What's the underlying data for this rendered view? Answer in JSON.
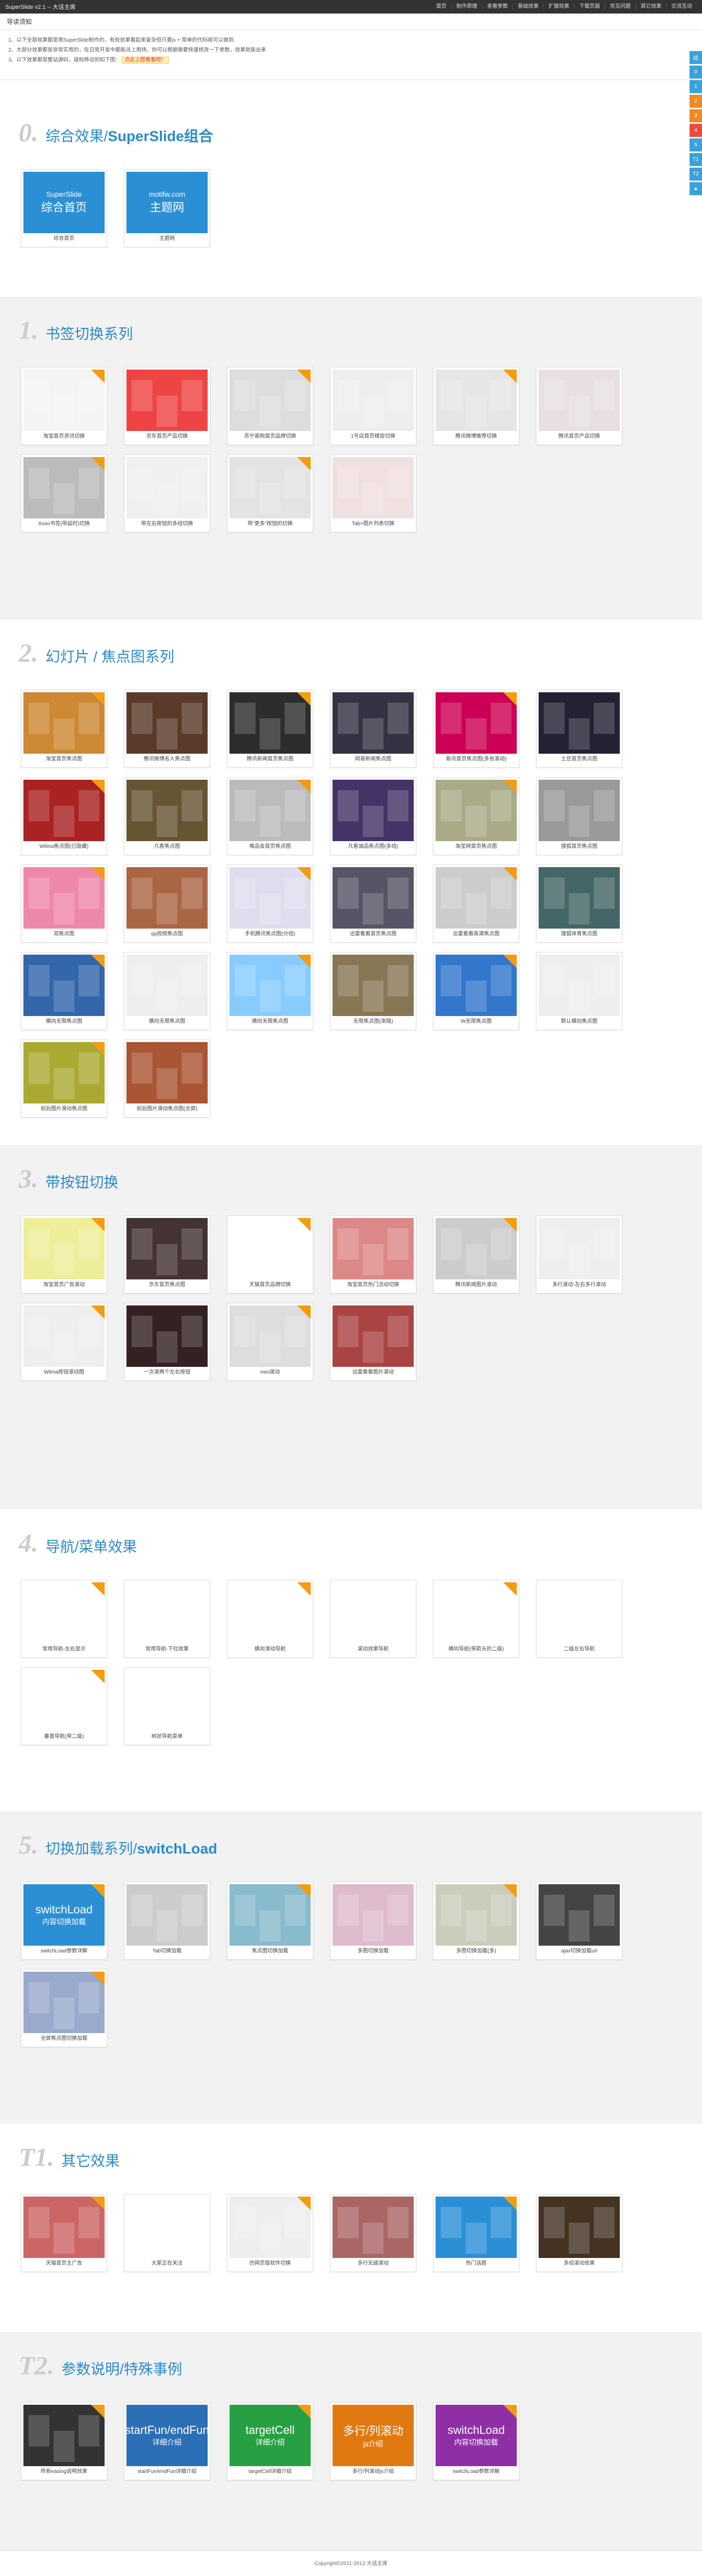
{
  "topbar": {
    "brand": "SuperSlide v2.1 -- 大话主席",
    "nav": [
      "首页",
      "制作原理",
      "查看参数",
      "基础效果",
      "扩展效果",
      "下载页面",
      "常见问题",
      "其它效果",
      "交流互动"
    ]
  },
  "guide": "导读须知",
  "notes": {
    "n1": "1、以下全部效果都是用SuperSlide制作的，有些效果看起来复杂但只要js + 简单的代码就可以做到",
    "n2": "2、大部分效果都是非常实用的，在日常开发中都能派上用场，你可以根据需要快速修改一下参数，效果就能出来",
    "n3": "3、以下效果都是整站源码，鼠标移动到如下图：",
    "n3_hl": "点此上图看看吧！"
  },
  "side_tabs": [
    {
      "label": "综",
      "color": "#3ba1da"
    },
    {
      "label": "0",
      "color": "#3ba1da"
    },
    {
      "label": "1",
      "color": "#3ba1da"
    },
    {
      "label": "2",
      "color": "#f08a24"
    },
    {
      "label": "3",
      "color": "#f08a24"
    },
    {
      "label": "4",
      "color": "#e84c3d"
    },
    {
      "label": "5",
      "color": "#3ba1da"
    },
    {
      "label": "T1",
      "color": "#3ba1da"
    },
    {
      "label": "T2",
      "color": "#3ba1da"
    },
    {
      "label": "▲",
      "color": "#3ba1da"
    }
  ],
  "sections": [
    {
      "num": "0.",
      "title": "综合效果/",
      "title_b": "SuperSlide组合",
      "cards": [
        {
          "caption": "综合首页",
          "thumb_main": "综合首页",
          "thumb_sub": "SuperSlide",
          "bg": "#2b8fd6"
        },
        {
          "caption": "主题网",
          "thumb_main": "主题网",
          "thumb_sub": "motifw.com",
          "bg": "#2b8fd6"
        }
      ]
    },
    {
      "num": "1.",
      "title": "书签切换系列",
      "title_b": "",
      "cards": [
        {
          "caption": "淘宝首页资讯切换",
          "bg": "#f4f4f4"
        },
        {
          "caption": "京东首页产品切换",
          "bg": "#e44"
        },
        {
          "caption": "苏宁易购首页品牌切换",
          "bg": "#ddd"
        },
        {
          "caption": "1号店首页楼层切换",
          "bg": "#eee"
        },
        {
          "caption": "腾讯微博推荐切换",
          "bg": "#e6e6e6"
        },
        {
          "caption": "腾讯首页产品切换",
          "bg": "#e8e0e0"
        },
        {
          "caption": "Xoxo书签(带延时)切换",
          "bg": "#bbb"
        },
        {
          "caption": "带左右按钮的多组切换",
          "bg": "#f0f0f0"
        },
        {
          "caption": "带\"更多\"按钮的切换",
          "bg": "#e3e3e3"
        },
        {
          "caption": "Tab+图片列表切换",
          "bg": "#f1e0e0"
        }
      ]
    },
    {
      "num": "2.",
      "title": "幻灯片 / 焦点图系列",
      "title_b": "",
      "cards": [
        {
          "caption": "淘宝首页焦点图",
          "bg": "#c83"
        },
        {
          "caption": "腾讯微博名人焦点图",
          "bg": "#5a3a2a"
        },
        {
          "caption": "腾讯新闻首页焦点图",
          "bg": "#2d2d2d"
        },
        {
          "caption": "网易新闻焦点图",
          "bg": "#334"
        },
        {
          "caption": "易讯首页焦点图(多张滚动)",
          "bg": "#c05"
        },
        {
          "caption": "土豆首页焦点图",
          "bg": "#223"
        },
        {
          "caption": "Wilma焦点图(已隐藏)",
          "bg": "#a22"
        },
        {
          "caption": "凡客焦点图",
          "bg": "#653"
        },
        {
          "caption": "唯品会首页焦点图",
          "bg": "#bbb"
        },
        {
          "caption": "凡客诚品焦点图(多组)",
          "bg": "#436"
        },
        {
          "caption": "淘宝网首页焦点图",
          "bg": "#aa8"
        },
        {
          "caption": "搜狐首页焦点图",
          "bg": "#999"
        },
        {
          "caption": "双焦点图",
          "bg": "#e8a"
        },
        {
          "caption": "qq视频焦点图",
          "bg": "#a64"
        },
        {
          "caption": "手机腾讯焦点图(分组)",
          "bg": "#dde"
        },
        {
          "caption": "迅雷看看首页焦点图",
          "bg": "#556"
        },
        {
          "caption": "迅雷看看高清焦点图",
          "bg": "#ccc"
        },
        {
          "caption": "搜狐体育焦点图",
          "bg": "#466"
        },
        {
          "caption": "横向无限焦点图",
          "bg": "#36a"
        },
        {
          "caption": "横向无限焦点图",
          "bg": "#eee"
        },
        {
          "caption": "横向无限焦点图",
          "bg": "#8cf"
        },
        {
          "caption": "无限焦点图(渐隐)",
          "bg": "#875"
        },
        {
          "caption": "W无限焦点图",
          "bg": "#37c"
        },
        {
          "caption": "默认横向焦点图",
          "bg": "#eee"
        },
        {
          "caption": "前后图片滑动焦点图",
          "bg": "#aa3"
        },
        {
          "caption": "前后图片滑动焦点图(全屏)",
          "bg": "#a53"
        }
      ]
    },
    {
      "num": "3.",
      "title": "带按钮切换",
      "title_b": "",
      "cards": [
        {
          "caption": "淘宝首页广告滚动",
          "bg": "#ee9"
        },
        {
          "caption": "京东首页焦点图",
          "bg": "#433"
        },
        {
          "caption": "天猫首页品牌切换",
          "bg": "#fff"
        },
        {
          "caption": "淘宝首页热门活动切换",
          "bg": "#d88"
        },
        {
          "caption": "腾讯新闻图片滚动",
          "bg": "#ccc"
        },
        {
          "caption": "多行滚动-左右多行滚动",
          "bg": "#eee"
        },
        {
          "caption": "Wilma按钮滚动图",
          "bg": "#eee"
        },
        {
          "caption": "一次滚两个左右按钮",
          "bg": "#322"
        },
        {
          "caption": "mini滚动",
          "bg": "#ddd"
        },
        {
          "caption": "迅雷看看图片滚动",
          "bg": "#a44"
        }
      ]
    },
    {
      "num": "4.",
      "title": "导航/菜单效果",
      "title_b": "",
      "cards": [
        {
          "caption": "常用导航-左右显示",
          "bg": "#fff"
        },
        {
          "caption": "常用导航-下拉效果",
          "bg": "#fff"
        },
        {
          "caption": "横向滑动导航",
          "bg": "#fff"
        },
        {
          "caption": "滚动效果导航",
          "bg": "#fff"
        },
        {
          "caption": "横向导航(带箭头的二级)",
          "bg": "#fff"
        },
        {
          "caption": "二级左右导航",
          "bg": "#fff"
        },
        {
          "caption": "垂直导航(带二级)",
          "bg": "#fff"
        },
        {
          "caption": "树状导航菜单",
          "bg": "#fff"
        }
      ]
    },
    {
      "num": "5.",
      "title": "切换加载系列/",
      "title_b": "switchLoad",
      "cards": [
        {
          "caption": "switchLoad参数详解",
          "thumb_main": "switchLoad",
          "thumb_sub": "内容切换加载",
          "bg": "#2b8fd6"
        },
        {
          "caption": "Tab切换加载",
          "bg": "#ccc"
        },
        {
          "caption": "焦点图切换加载",
          "bg": "#8bc"
        },
        {
          "caption": "多图切换加载",
          "bg": "#dbc"
        },
        {
          "caption": "多图切换加载(多)",
          "bg": "#ccb"
        },
        {
          "caption": "ajax切换加载url",
          "bg": "#444"
        },
        {
          "caption": "全屏焦点图切换加载",
          "bg": "#9ac"
        }
      ]
    },
    {
      "num": "T1.",
      "title": "其它效果",
      "title_b": "",
      "cards": [
        {
          "caption": "天猫首页主广告",
          "bg": "#c66"
        },
        {
          "caption": "大家正在关注",
          "bg": "#fff"
        },
        {
          "caption": "仿网页版软件切换",
          "bg": "#eee"
        },
        {
          "caption": "多行无缝滚动",
          "bg": "#a66"
        },
        {
          "caption": "热门话题",
          "bg": "#2b8fd6"
        },
        {
          "caption": "多组滚动效果",
          "bg": "#432"
        }
      ]
    },
    {
      "num": "T2.",
      "title": "参数说明/特殊事例",
      "title_b": "",
      "cards": [
        {
          "caption": "所有easing说明效果",
          "bg": "#333"
        },
        {
          "caption": "startFun/endFun详细介绍",
          "thumb_main": "startFun/endFun",
          "thumb_sub": "详细介绍",
          "bg": "#2b6fb6"
        },
        {
          "caption": "targetCell详细介绍",
          "thumb_main": "targetCell",
          "thumb_sub": "详细介绍",
          "bg": "#27a043"
        },
        {
          "caption": "多行/列滚动js介绍",
          "thumb_main": "多行/列滚动",
          "thumb_sub": "js介绍",
          "bg": "#e07a10"
        },
        {
          "caption": "switchLoad参数详解",
          "thumb_main": "switchLoad",
          "thumb_sub": "内容切换加载",
          "bg": "#8e2fa5"
        }
      ]
    }
  ],
  "footer": "Copyright©2011-2013 大话主席"
}
